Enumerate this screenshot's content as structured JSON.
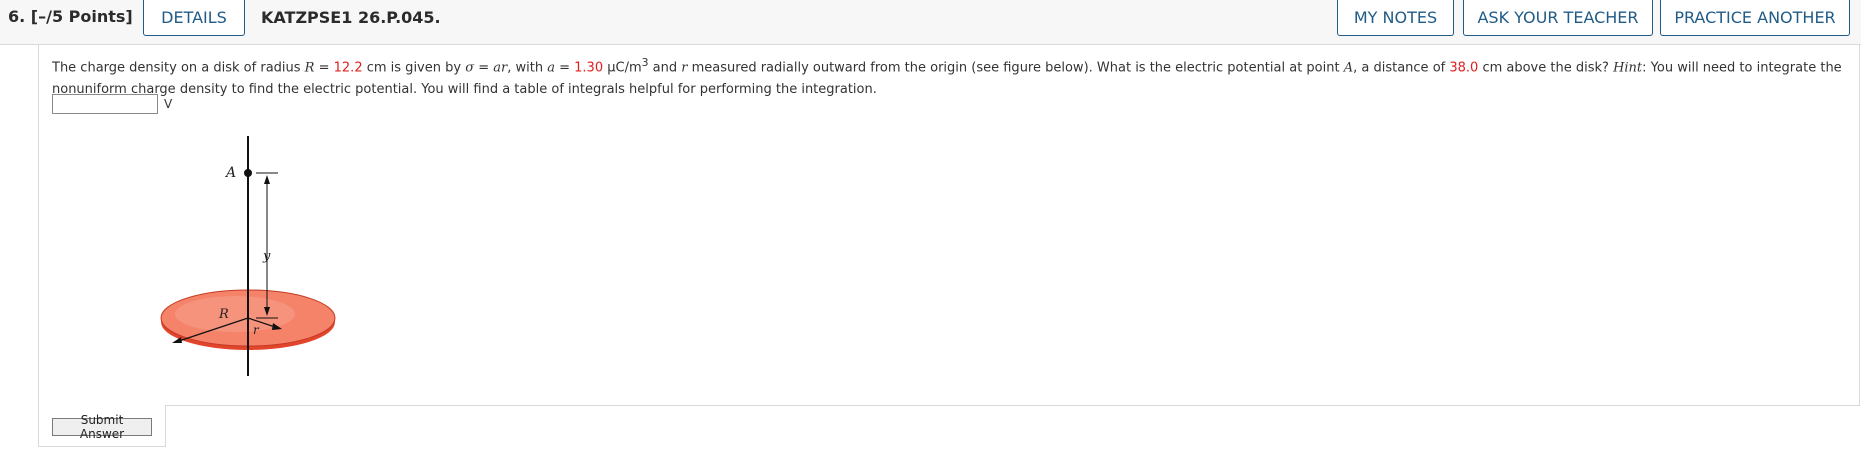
{
  "header": {
    "question_number": "6.",
    "points": "[–/5 Points]",
    "details_label": "DETAILS",
    "question_code": "KATZPSE1 26.P.045.",
    "my_notes_label": "MY NOTES",
    "ask_teacher_label": "ASK YOUR TEACHER",
    "practice_another_label": "PRACTICE ANOTHER"
  },
  "question": {
    "t1": "The charge density on a disk of radius ",
    "R_sym": "R",
    "eq": " = ",
    "R_value": "12.2",
    "t2": " cm  is given by ",
    "sigma": "σ",
    "t3": " = ",
    "a_sym": "a",
    "r_sym": "r",
    "t4": ",  with ",
    "a_sym2": "a",
    "eq2": " = ",
    "a_value": "1.30",
    "t5": " μC/m",
    "t5_sup": "3",
    "t6": "  and ",
    "r_sym2": "r",
    "t7": " measured radially outward from the origin (see figure below). What is the electric potential at point ",
    "A_sym": "A",
    "t8": ", a distance of ",
    "dist_value": "38.0",
    "t9": " cm above the disk? ",
    "hint_label": "Hint",
    "t10": ": You will need to integrate the nonuniform charge density to find the electric potential. You will find a table of integrals helpful for performing the integration."
  },
  "answer": {
    "value": "",
    "unit": "V"
  },
  "figure": {
    "label_A": "A",
    "label_y": "y",
    "label_R": "R",
    "label_r": "r",
    "disk_color": "#f4836a"
  },
  "submit_label": "Submit Answer"
}
